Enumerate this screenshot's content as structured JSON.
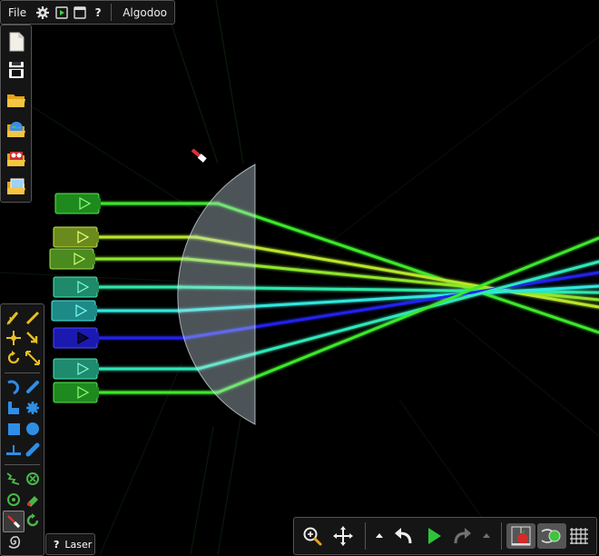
{
  "menubar": {
    "file": "File",
    "help": "?",
    "app_name": "Algodoo"
  },
  "tool_label": {
    "help": "?",
    "name": "Laser"
  },
  "colors": {
    "laser_green": "#3ee82a",
    "laser_yellowgreen": "#b8e62a",
    "laser_cyan": "#2ee8c8",
    "laser_blue": "#2222ee",
    "lens_fill": "#c8dce8",
    "panel_bg": "#161616",
    "play_green": "#2ec43a"
  },
  "icons": [
    "gear-icon",
    "play-scene-icon",
    "window-icon",
    "new-scene-icon",
    "save-icon",
    "open-folder-icon",
    "planet-icon",
    "phunlets-icon",
    "screenshot-icon",
    "zoom-icon",
    "pan-icon",
    "undo-icon",
    "play-icon",
    "redo-icon",
    "gravity-icon",
    "air-friction-icon",
    "grid-icon"
  ]
}
